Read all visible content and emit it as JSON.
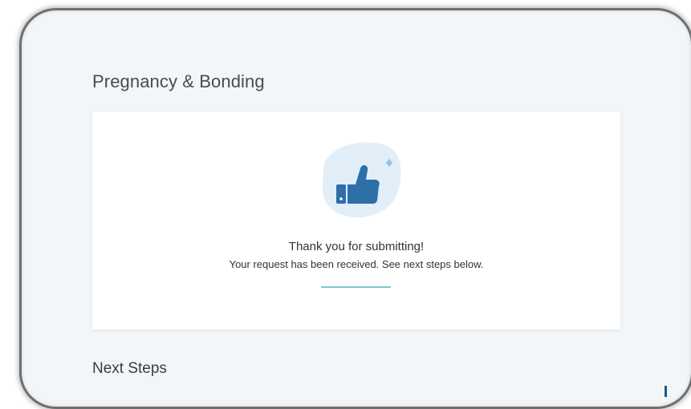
{
  "page": {
    "title": "Pregnancy & Bonding"
  },
  "confirmation": {
    "icon": "thumbs-up-icon",
    "heading": "Thank you for submitting!",
    "message": "Your request has been received. See next steps below.",
    "accent_color": "#2f6fa8",
    "underline_color": "#7fc7d6"
  },
  "next_steps": {
    "title": "Next Steps"
  }
}
